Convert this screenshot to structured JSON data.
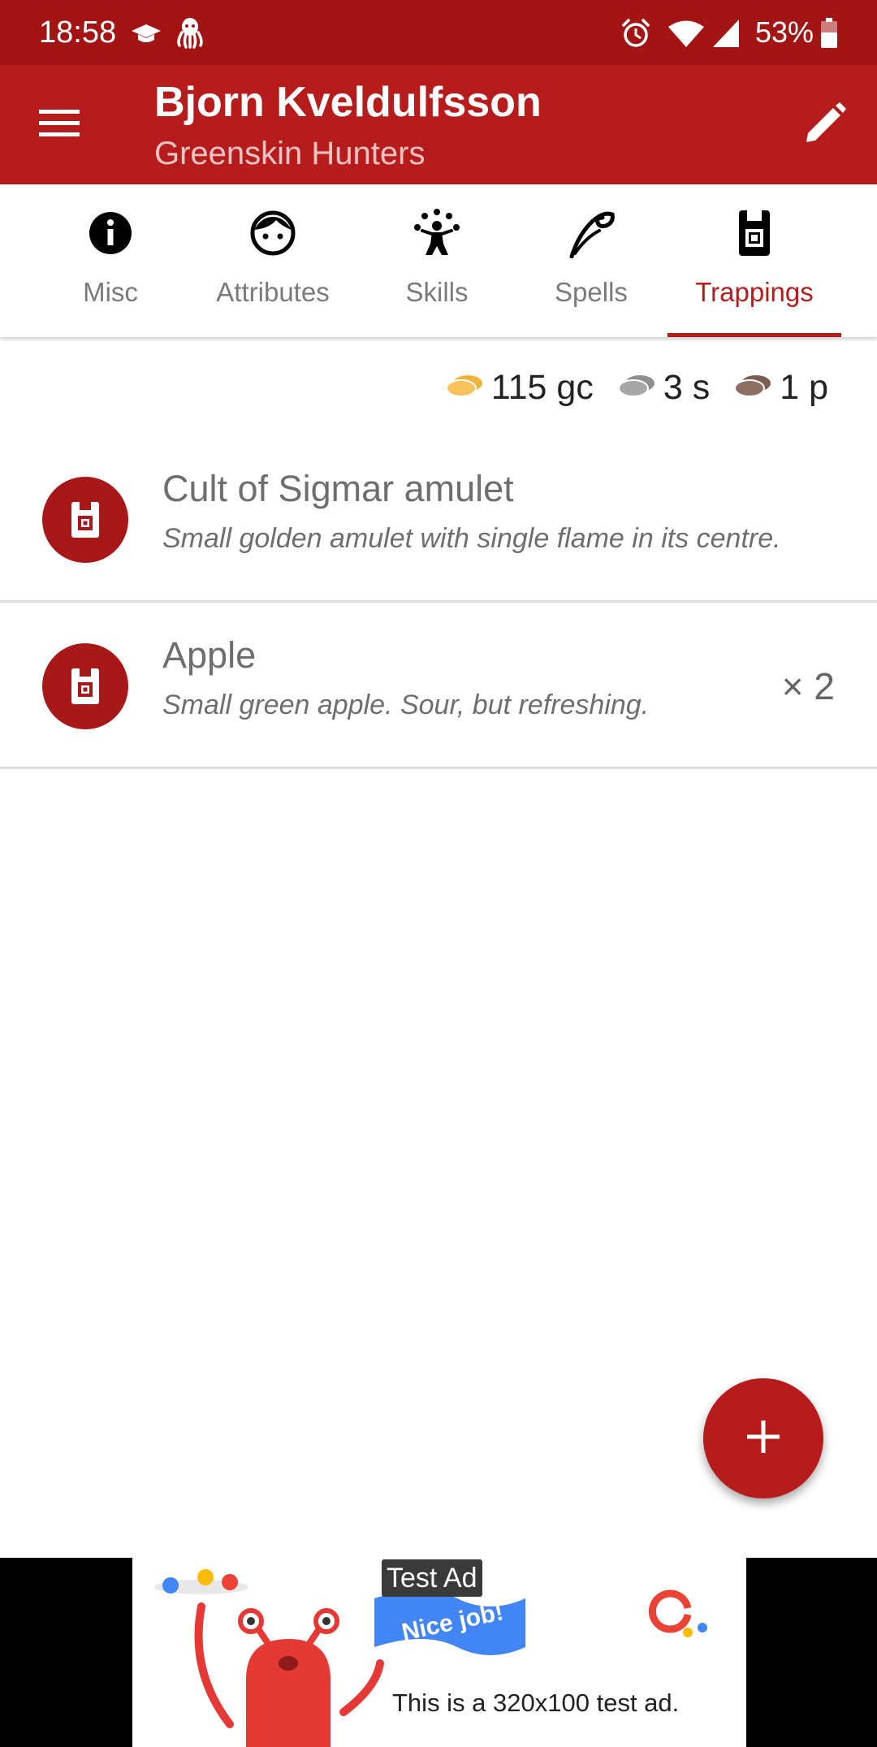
{
  "status_bar": {
    "time": "18:58",
    "battery": "53%",
    "icons": [
      "graduation-cap-icon",
      "octopus-icon",
      "alarm-icon",
      "wifi-icon",
      "signal-icon",
      "battery-icon"
    ]
  },
  "app_bar": {
    "title": "Bjorn Kveldulfsson",
    "subtitle": "Greenskin Hunters",
    "menu_icon": "menu-icon",
    "edit_icon": "edit-pencil-icon"
  },
  "tabs": [
    {
      "label": "Misc",
      "icon": "info-icon",
      "active": false
    },
    {
      "label": "Attributes",
      "icon": "face-icon",
      "active": false
    },
    {
      "label": "Skills",
      "icon": "juggler-icon",
      "active": false
    },
    {
      "label": "Spells",
      "icon": "quill-icon",
      "active": false
    },
    {
      "label": "Trappings",
      "icon": "backpack-icon",
      "active": true
    }
  ],
  "money": {
    "gold": "115 gc",
    "silver": "3 s",
    "brass": "1 p"
  },
  "items": [
    {
      "name": "Cult of Sigmar amulet",
      "description": "Small golden amulet with single flame in its centre.",
      "quantity": ""
    },
    {
      "name": "Apple",
      "description": "Small green apple. Sour, but refreshing.",
      "quantity": "× 2"
    }
  ],
  "fab": {
    "icon": "plus-icon"
  },
  "ad": {
    "label": "Test Ad",
    "text": "This is a 320x100 test ad.",
    "banner_text": "Nice job!"
  },
  "colors": {
    "status_bar": "#a31515",
    "primary": "#b71c1c",
    "gold_coin": "#f2b33d",
    "silver_coin": "#9e9e9e",
    "brass_coin": "#8d6e63"
  }
}
